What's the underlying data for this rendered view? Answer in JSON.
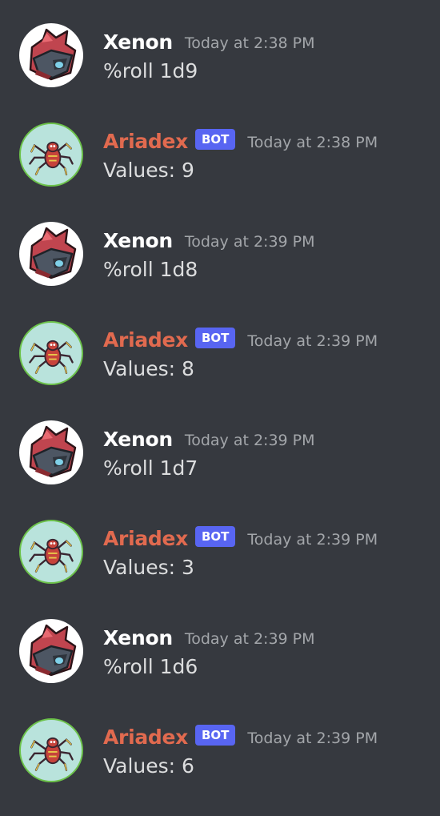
{
  "messages": [
    {
      "kind": "user",
      "author": "Xenon",
      "timestamp": "Today at 2:38 PM",
      "text": "%roll 1d9"
    },
    {
      "kind": "bot",
      "author": "Ariadex",
      "badge": "BOT",
      "timestamp": "Today at 2:38 PM",
      "text": "Values: 9"
    },
    {
      "kind": "user",
      "author": "Xenon",
      "timestamp": "Today at 2:39 PM",
      "text": "%roll 1d8"
    },
    {
      "kind": "bot",
      "author": "Ariadex",
      "badge": "BOT",
      "timestamp": "Today at 2:39 PM",
      "text": "Values: 8"
    },
    {
      "kind": "user",
      "author": "Xenon",
      "timestamp": "Today at 2:39 PM",
      "text": "%roll 1d7"
    },
    {
      "kind": "bot",
      "author": "Ariadex",
      "badge": "BOT",
      "timestamp": "Today at 2:39 PM",
      "text": "Values: 3"
    },
    {
      "kind": "user",
      "author": "Xenon",
      "timestamp": "Today at 2:39 PM",
      "text": "%roll 1d6"
    },
    {
      "kind": "bot",
      "author": "Ariadex",
      "badge": "BOT",
      "timestamp": "Today at 2:39 PM",
      "text": "Values: 6"
    }
  ],
  "colors": {
    "background": "#36393f",
    "user_name": "#ffffff",
    "bot_name": "#e16a4f",
    "bot_badge": "#5865f2",
    "timestamp": "#a3a6aa",
    "message_text": "#dcddde"
  },
  "icons": {
    "user_avatar": "red-helmet-avatar-icon",
    "bot_avatar": "spider-avatar-icon"
  }
}
